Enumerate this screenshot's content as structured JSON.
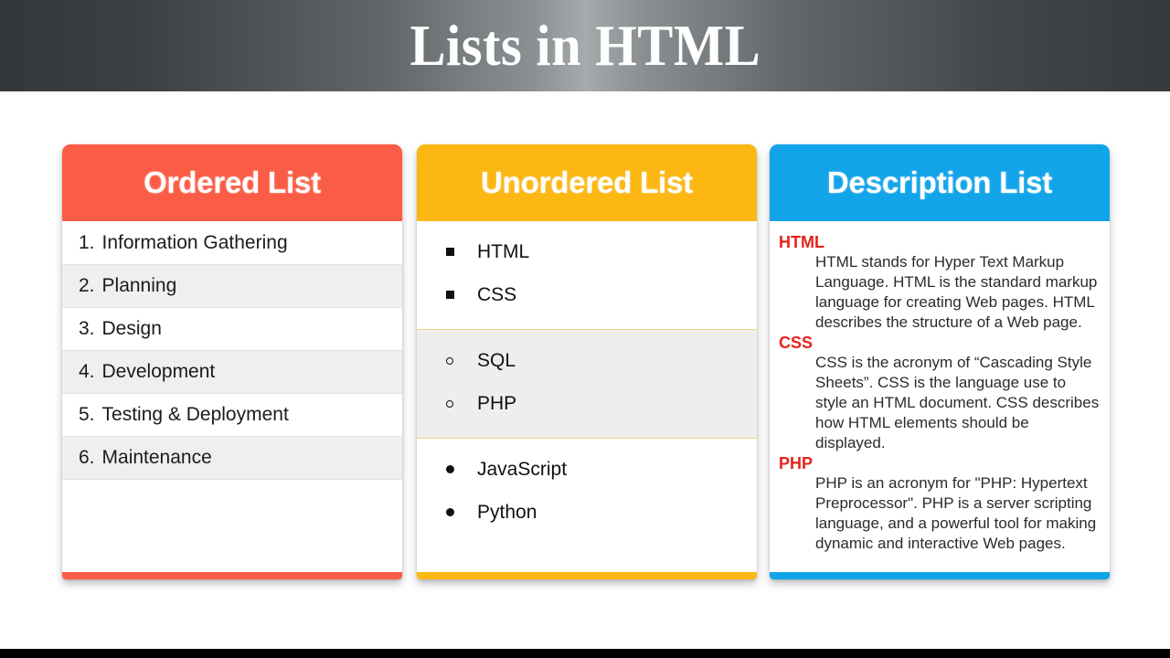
{
  "slide": {
    "title": "Lists in HTML",
    "title_bar_color_left": "#343739",
    "title_bar_color_center": "#a5aaac",
    "background": "#ffffff"
  },
  "cards": [
    {
      "id": "ordered-list",
      "heading": "Ordered List",
      "accent_color": "#fb5c45",
      "items": [
        {
          "number": "1.",
          "label": "Information Gathering"
        },
        {
          "number": "2.",
          "label": "Planning"
        },
        {
          "number": "3.",
          "label": "Design"
        },
        {
          "number": "4.",
          "label": "Development"
        },
        {
          "number": "5.",
          "label": "Testing & Deployment"
        },
        {
          "number": "6.",
          "label": "Maintenance"
        }
      ]
    },
    {
      "id": "unordered-list",
      "heading": "Unordered List",
      "accent_color": "#fcb713",
      "groups": [
        {
          "bullet_style": "square",
          "shaded": false,
          "items": [
            "HTML",
            "CSS"
          ]
        },
        {
          "bullet_style": "circle",
          "shaded": true,
          "items": [
            "SQL",
            "PHP"
          ]
        },
        {
          "bullet_style": "disc",
          "shaded": false,
          "items": [
            "JavaScript",
            "Python"
          ]
        }
      ]
    },
    {
      "id": "description-list",
      "heading": "Description List",
      "accent_color": "#12a4e8",
      "term_color": "#e5231b",
      "entries": [
        {
          "term": "HTML",
          "description": "HTML stands for Hyper Text Markup Language. HTML is the standard markup language for creating Web pages. HTML describes the structure of a Web page."
        },
        {
          "term": "CSS",
          "description": "CSS is the acronym of “Cascading Style Sheets”. CSS is the language use to style an HTML document. CSS describes how HTML elements should be displayed."
        },
        {
          "term": "PHP",
          "description": "PHP is an acronym for \"PHP: Hypertext Preprocessor\". PHP is a server scripting language, and a powerful tool for making dynamic and interactive Web pages."
        }
      ]
    }
  ]
}
